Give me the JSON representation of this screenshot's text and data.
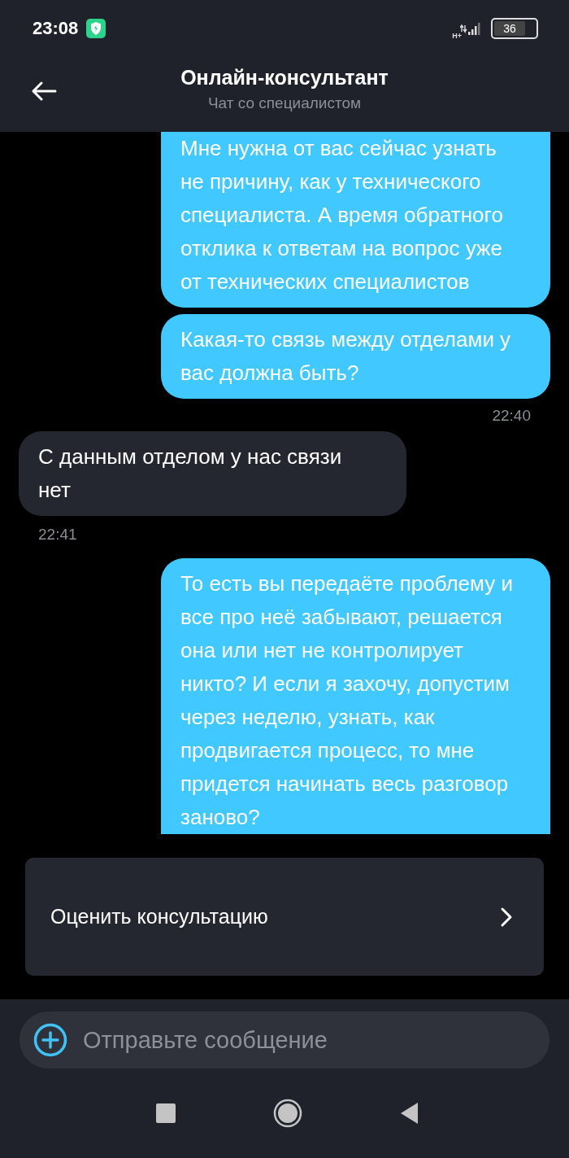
{
  "status_bar": {
    "time": "23:08",
    "network": "H+",
    "battery": "36"
  },
  "header": {
    "title": "Онлайн-консультант",
    "subtitle": "Чат со специалистом"
  },
  "messages": [
    {
      "kind": "outgoing",
      "text": "Мне нужна от вас сейчас узнать не причину, как у технического специалиста. А время обратного отклика к ответам на вопрос уже от технических специалистов",
      "cut_top": true,
      "cut_bottom": false
    },
    {
      "kind": "outgoing",
      "text": "Какая-то связь между отделами у вас должна быть?",
      "time": "22:40",
      "cut_top": false,
      "cut_bottom": false
    },
    {
      "kind": "incoming",
      "text": "С данным отделом у нас связи нет",
      "time": "22:41",
      "cut_top": false,
      "cut_bottom": false
    },
    {
      "kind": "outgoing",
      "text": "То есть вы передаёте проблему и все про неё забывают, решается она или нет не контролирует никто? И если я захочу, допустим через неделю, узнать, как продвигается процесс, то мне придется начинать весь разговор заново?",
      "cut_top": false,
      "cut_bottom": true
    }
  ],
  "rating": {
    "label": "Оценить консультацию"
  },
  "composer": {
    "placeholder": "Отправьте сообщение"
  }
}
